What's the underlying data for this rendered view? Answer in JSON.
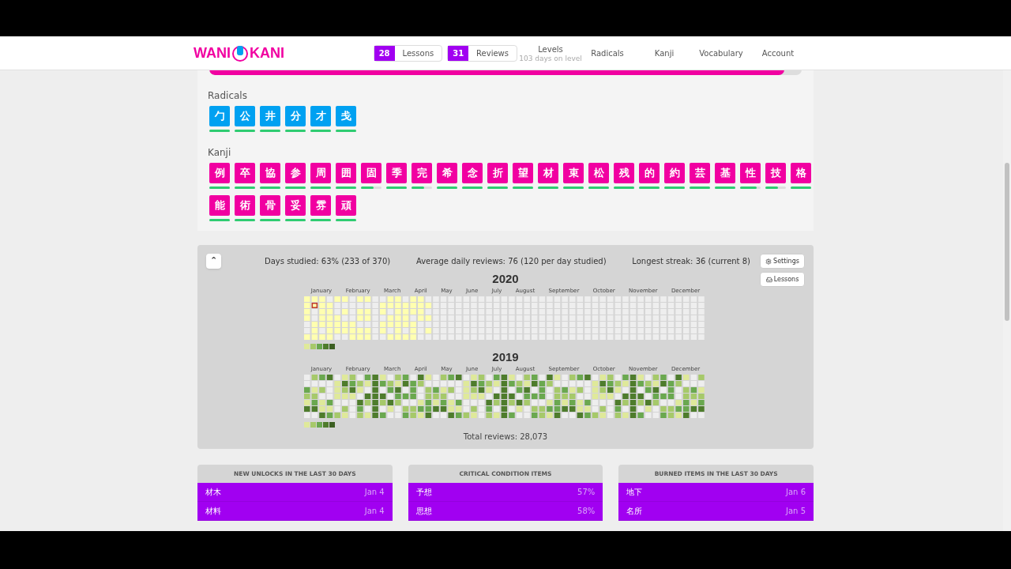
{
  "header": {
    "logo": [
      "WANI",
      "KANI"
    ],
    "nav": [
      {
        "kind": "count",
        "count": "28",
        "label": "Lessons"
      },
      {
        "kind": "count",
        "count": "31",
        "label": "Reviews"
      },
      {
        "kind": "link",
        "label": "Levels",
        "subtitle": "103 days on level"
      },
      {
        "kind": "link",
        "label": "Radicals"
      },
      {
        "kind": "link",
        "label": "Kanji"
      },
      {
        "kind": "link",
        "label": "Vocabulary"
      },
      {
        "kind": "link",
        "label": "Account"
      }
    ]
  },
  "level_progress": {
    "level": 0.97
  },
  "sections": [
    {
      "title": "Radicals",
      "kind": "radical",
      "items": [
        {
          "char": "勹",
          "level": 1
        },
        {
          "char": "公",
          "level": 1
        },
        {
          "char": "井",
          "level": 1
        },
        {
          "char": "分",
          "level": 1
        },
        {
          "char": "才",
          "level": 1
        },
        {
          "char": "戋",
          "level": 1
        }
      ]
    },
    {
      "title": "Kanji",
      "kind": "kanji",
      "items": [
        {
          "char": "例",
          "level": 1
        },
        {
          "char": "卒",
          "level": 1
        },
        {
          "char": "協",
          "level": 1
        },
        {
          "char": "参",
          "level": 1
        },
        {
          "char": "周",
          "level": 1
        },
        {
          "char": "囲",
          "level": 1
        },
        {
          "char": "固",
          "level": 0.6
        },
        {
          "char": "季",
          "level": 1
        },
        {
          "char": "完",
          "level": 0.6
        },
        {
          "char": "希",
          "level": 1
        },
        {
          "char": "念",
          "level": 1
        },
        {
          "char": "折",
          "level": 1
        },
        {
          "char": "望",
          "level": 1
        },
        {
          "char": "材",
          "level": 1
        },
        {
          "char": "束",
          "level": 1
        },
        {
          "char": "松",
          "level": 1
        },
        {
          "char": "残",
          "level": 1
        },
        {
          "char": "的",
          "level": 1
        },
        {
          "char": "約",
          "level": 1
        },
        {
          "char": "芸",
          "level": 1
        },
        {
          "char": "基",
          "level": 1
        },
        {
          "char": "性",
          "level": 0.8
        },
        {
          "char": "技",
          "level": 0.6
        },
        {
          "char": "格",
          "level": 1
        },
        {
          "char": "能",
          "level": 1
        },
        {
          "char": "術",
          "level": 1
        },
        {
          "char": "骨",
          "level": 1
        },
        {
          "char": "妥",
          "level": 1
        },
        {
          "char": "雰",
          "level": 1
        },
        {
          "char": "頑",
          "level": 1
        }
      ]
    }
  ],
  "heatmap": {
    "collapse": "⌃",
    "stats": [
      "Days studied: 63% (233 of 370)",
      "Average daily reviews: 76 (120 per day studied)",
      "Longest streak: 36 (current 8)"
    ],
    "buttons": [
      {
        "kind": "settings",
        "label": "Settings"
      },
      {
        "kind": "lessons",
        "label": "Lessons"
      }
    ],
    "years": [
      {
        "year": "2020",
        "kind": "current",
        "months": [
          "January",
          "February",
          "March",
          "April",
          "May",
          "June",
          "July",
          "August",
          "September",
          "October",
          "November",
          "December"
        ]
      },
      {
        "year": "2019",
        "kind": "past",
        "months": [
          "January",
          "February",
          "March",
          "April",
          "May",
          "June",
          "July",
          "August",
          "September",
          "October",
          "November",
          "December"
        ]
      }
    ],
    "total": "Total reviews: 28,073"
  },
  "cards": [
    {
      "title": "NEW UNLOCKS IN THE LAST 30 DAYS",
      "rows": [
        {
          "item": "材木",
          "value": "Jan 4"
        },
        {
          "item": "材料",
          "value": "Jan 4"
        }
      ]
    },
    {
      "title": "CRITICAL CONDITION ITEMS",
      "rows": [
        {
          "item": "予想",
          "value": "57%"
        },
        {
          "item": "思想",
          "value": "58%"
        }
      ]
    },
    {
      "title": "BURNED ITEMS IN THE LAST 30 DAYS",
      "rows": [
        {
          "item": "地下",
          "value": "Jan 6"
        },
        {
          "item": "名所",
          "value": "Jan 5"
        }
      ]
    }
  ]
}
